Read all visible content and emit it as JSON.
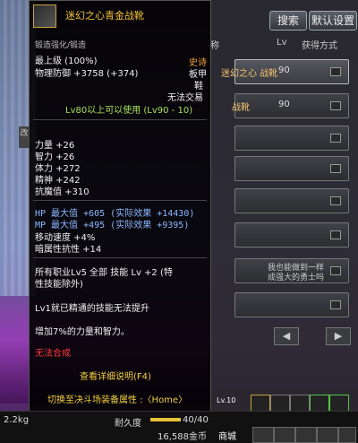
{
  "right_panel": {
    "search_label": "搜索",
    "default_label": "默认设置",
    "col_name_partial": "称",
    "col_lv": "Lv",
    "col_source": "获得方式",
    "rows": [
      {
        "name_partial": "迷幻之心 战靴",
        "lv": "90"
      },
      {
        "name_partial": "战靴",
        "lv": "90"
      }
    ],
    "partial_texts": [
      "我也能做到一样",
      "成强大的勇士吗"
    ],
    "nav_prev": "◀",
    "nav_next": "▶"
  },
  "tooltip": {
    "name": "迷幻之心青金战靴",
    "tab_partial": "锻造强化/锻造",
    "max_level": "最上级 (100%)",
    "defense": "物理防御 +3758 (+374)",
    "rarity": "史诗",
    "slot_type": "板甲",
    "slot_part": "鞋",
    "trade": "无法交易",
    "level_req": "Lv80以上可以使用 (Lv90 - 10)",
    "stats": [
      "力量 +26",
      "智力 +26",
      "体力 +272",
      "精神 +242",
      "抗魔值 +310"
    ],
    "special": [
      "HP 最大值 +605 (实际效果 +14430)",
      "MP 最大值 +495 (实际效果 +9395)",
      "移动速度 +4%",
      "暗属性抗性 +14"
    ],
    "skill_bonus": [
      "所有职业Lv5 全部 技能 Lv +2 (特",
      "性技能除外)"
    ],
    "mastery": "Lv1就已精通的技能无法提升",
    "set_bonus": "增加7%的力量和智力。",
    "no_synthesis": "无法合成",
    "details": "查看详细说明(F4)",
    "switch_pvp": "切换至决斗场装备属性 :〈Home〉"
  },
  "bottom": {
    "weight": "2.2kg",
    "durability_label": "耐久度",
    "durability": "40/40",
    "gold": "16,588金币",
    "shop": "商城",
    "lv10": "Lv.10"
  },
  "colors": {
    "epic": "#f2c23a",
    "green": "#a9e05a",
    "blue": "#8ab8ff",
    "red": "#ff3c3c"
  }
}
